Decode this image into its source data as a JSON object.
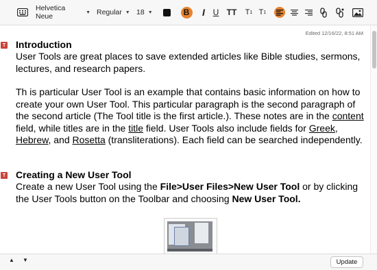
{
  "toolbar": {
    "font_family": "Helvetica Neue",
    "font_style": "Regular",
    "font_size": "18",
    "bold": "B",
    "italic": "I",
    "underline": "U",
    "text_transform": "TT",
    "superscript": "T",
    "subscript": "T",
    "accent_color": "#e8822d"
  },
  "document": {
    "edited": "Edited 12/16/22, 8:51 AM",
    "marker_label": "T",
    "sections": [
      {
        "heading": "Introduction",
        "p1": "User Tools are great places to save extended articles like Bible studies, sermons, lectures, and research papers.",
        "p2_a": "Th is particular User Tool is an example that contains basic information on how to create your own User Tool. This particular paragraph is the second paragraph of the second article (The Tool title is the first article.). These notes are in the ",
        "p2_content": "content",
        "p2_b": " field, while titles are in the ",
        "p2_title": "title",
        "p2_c": " field. User Tools also include fields for ",
        "p2_greek": "Greek",
        "p2_d": ", ",
        "p2_hebrew": "Hebrew",
        "p2_e": ", and ",
        "p2_rosetta": "Rosetta",
        "p2_f": " (transliterations). Each field can be searched independently."
      },
      {
        "heading": "Creating a New User Tool",
        "p1_a": "Create a new User Tool using the ",
        "p1_b": "File>User Files>New User Tool",
        "p1_c": " or by clicking the User Tools button on the Toolbar and choosing ",
        "p1_d": "New User Tool."
      }
    ]
  },
  "bottombar": {
    "update_label": "Update"
  }
}
